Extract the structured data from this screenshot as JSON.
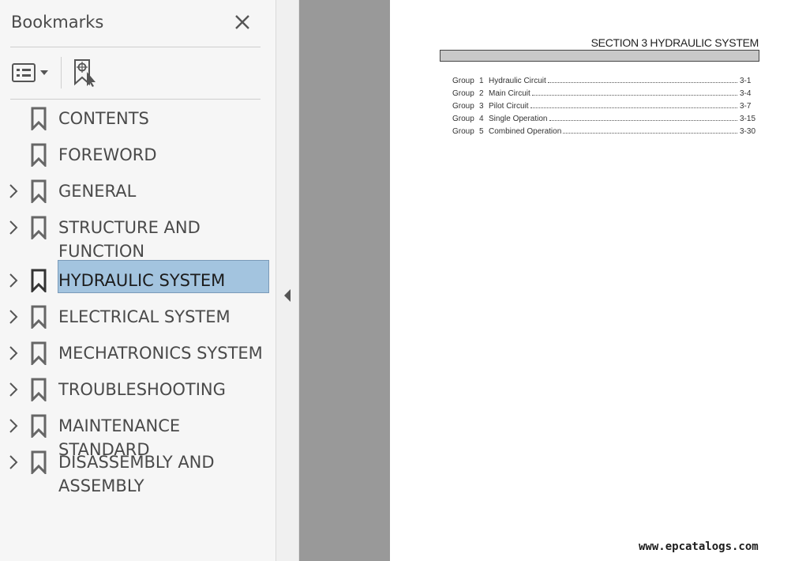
{
  "panel": {
    "title": "Bookmarks",
    "close_icon": "close-icon",
    "options_icon": "list-options-icon",
    "find_icon": "find-current-bookmark-icon"
  },
  "bookmarks": [
    {
      "label": "CONTENTS",
      "expandable": false,
      "selected": false
    },
    {
      "label": "FOREWORD",
      "expandable": false,
      "selected": false
    },
    {
      "label": "GENERAL",
      "expandable": true,
      "selected": false
    },
    {
      "label": "STRUCTURE AND\nFUNCTION",
      "expandable": true,
      "selected": false
    },
    {
      "label": "HYDRAULIC SYSTEM",
      "expandable": true,
      "selected": true
    },
    {
      "label": "ELECTRICAL SYSTEM",
      "expandable": true,
      "selected": false
    },
    {
      "label": "MECHATRONICS SYSTEM",
      "expandable": true,
      "selected": false
    },
    {
      "label": "TROUBLESHOOTING",
      "expandable": true,
      "selected": false
    },
    {
      "label": "MAINTENANCE STANDARD",
      "expandable": true,
      "selected": false
    },
    {
      "label": "DISASSEMBLY AND\nASSEMBLY",
      "expandable": true,
      "selected": false
    }
  ],
  "document": {
    "section_title": "SECTION  3  HYDRAULIC SYSTEM",
    "toc": [
      {
        "group": "Group",
        "num": "1",
        "title": "Hydraulic Circuit",
        "page": "3-1"
      },
      {
        "group": "Group",
        "num": "2",
        "title": "Main Circuit",
        "page": "3-4"
      },
      {
        "group": "Group",
        "num": "3",
        "title": "Pilot Circuit",
        "page": "3-7"
      },
      {
        "group": "Group",
        "num": "4",
        "title": "Single Operation",
        "page": "3-15"
      },
      {
        "group": "Group",
        "num": "5",
        "title": "Combined Operation",
        "page": "3-30"
      }
    ],
    "watermark": "www.epcatalogs.com"
  },
  "colors": {
    "selection": "#a3c4df",
    "panel_bg": "#f6f6f6",
    "doc_bg": "#999999"
  }
}
